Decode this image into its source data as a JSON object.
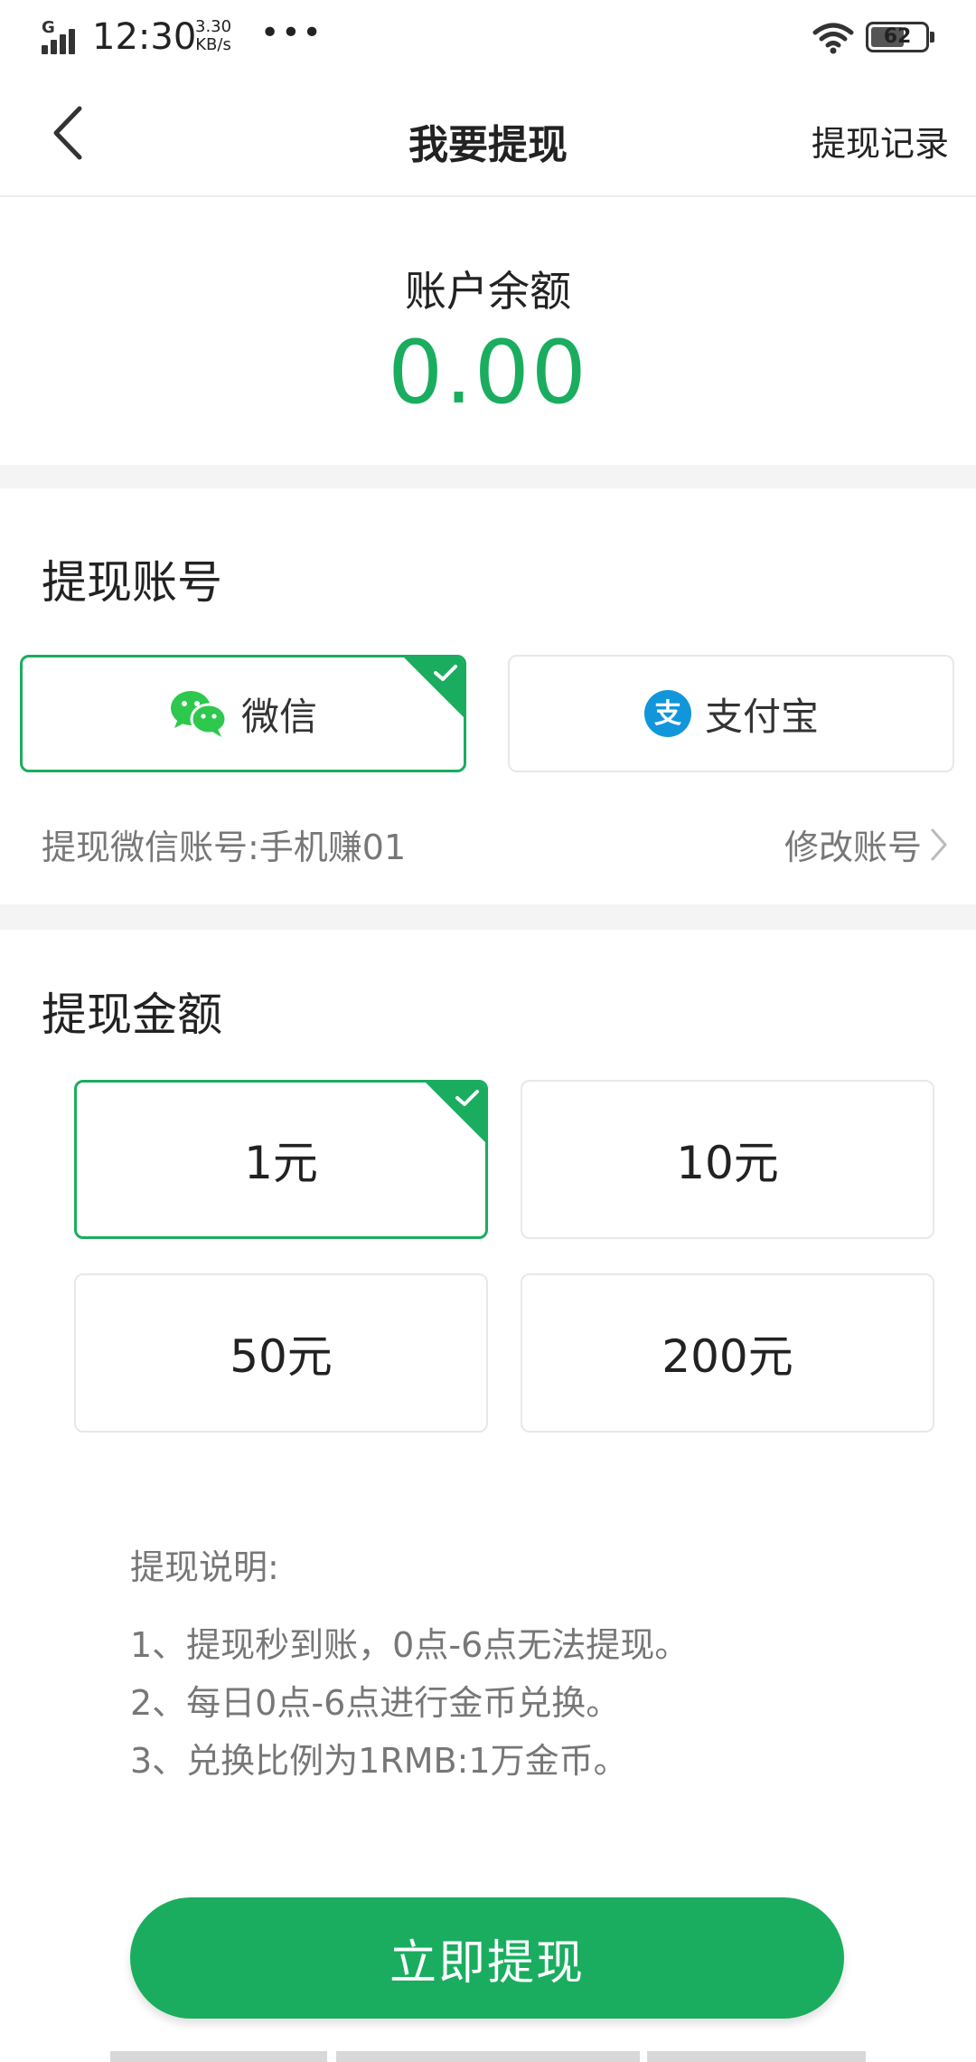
{
  "status_bar": {
    "network": "G",
    "time": "12:30",
    "speed_value": "3.30",
    "speed_unit": "KB/s",
    "more": "•••",
    "battery": "62"
  },
  "nav": {
    "title": "我要提现",
    "record_label": "提现记录"
  },
  "balance": {
    "label": "账户余额",
    "value": "0.00"
  },
  "account": {
    "section_title": "提现账号",
    "options": [
      {
        "label": "微信",
        "selected": true,
        "icon": "wechat-icon"
      },
      {
        "label": "支付宝",
        "selected": false,
        "icon": "alipay-icon"
      }
    ],
    "note": "提现微信账号:手机赚01",
    "edit_label": "修改账号"
  },
  "amount": {
    "section_title": "提现金额",
    "options": [
      {
        "label": "1元",
        "selected": true
      },
      {
        "label": "10元",
        "selected": false
      },
      {
        "label": "50元",
        "selected": false
      },
      {
        "label": "200元",
        "selected": false
      }
    ]
  },
  "instructions": {
    "title": "提现说明:",
    "items": [
      "1、提现秒到账，0点-6点无法提现。",
      "2、每日0点-6点进行金币兑换。",
      "3、兑换比例为1RMB:1万金币。"
    ]
  },
  "submit_label": "立即提现",
  "colors": {
    "accent": "#1aad5f",
    "wechat": "#2dc84d",
    "alipay": "#1296db"
  }
}
